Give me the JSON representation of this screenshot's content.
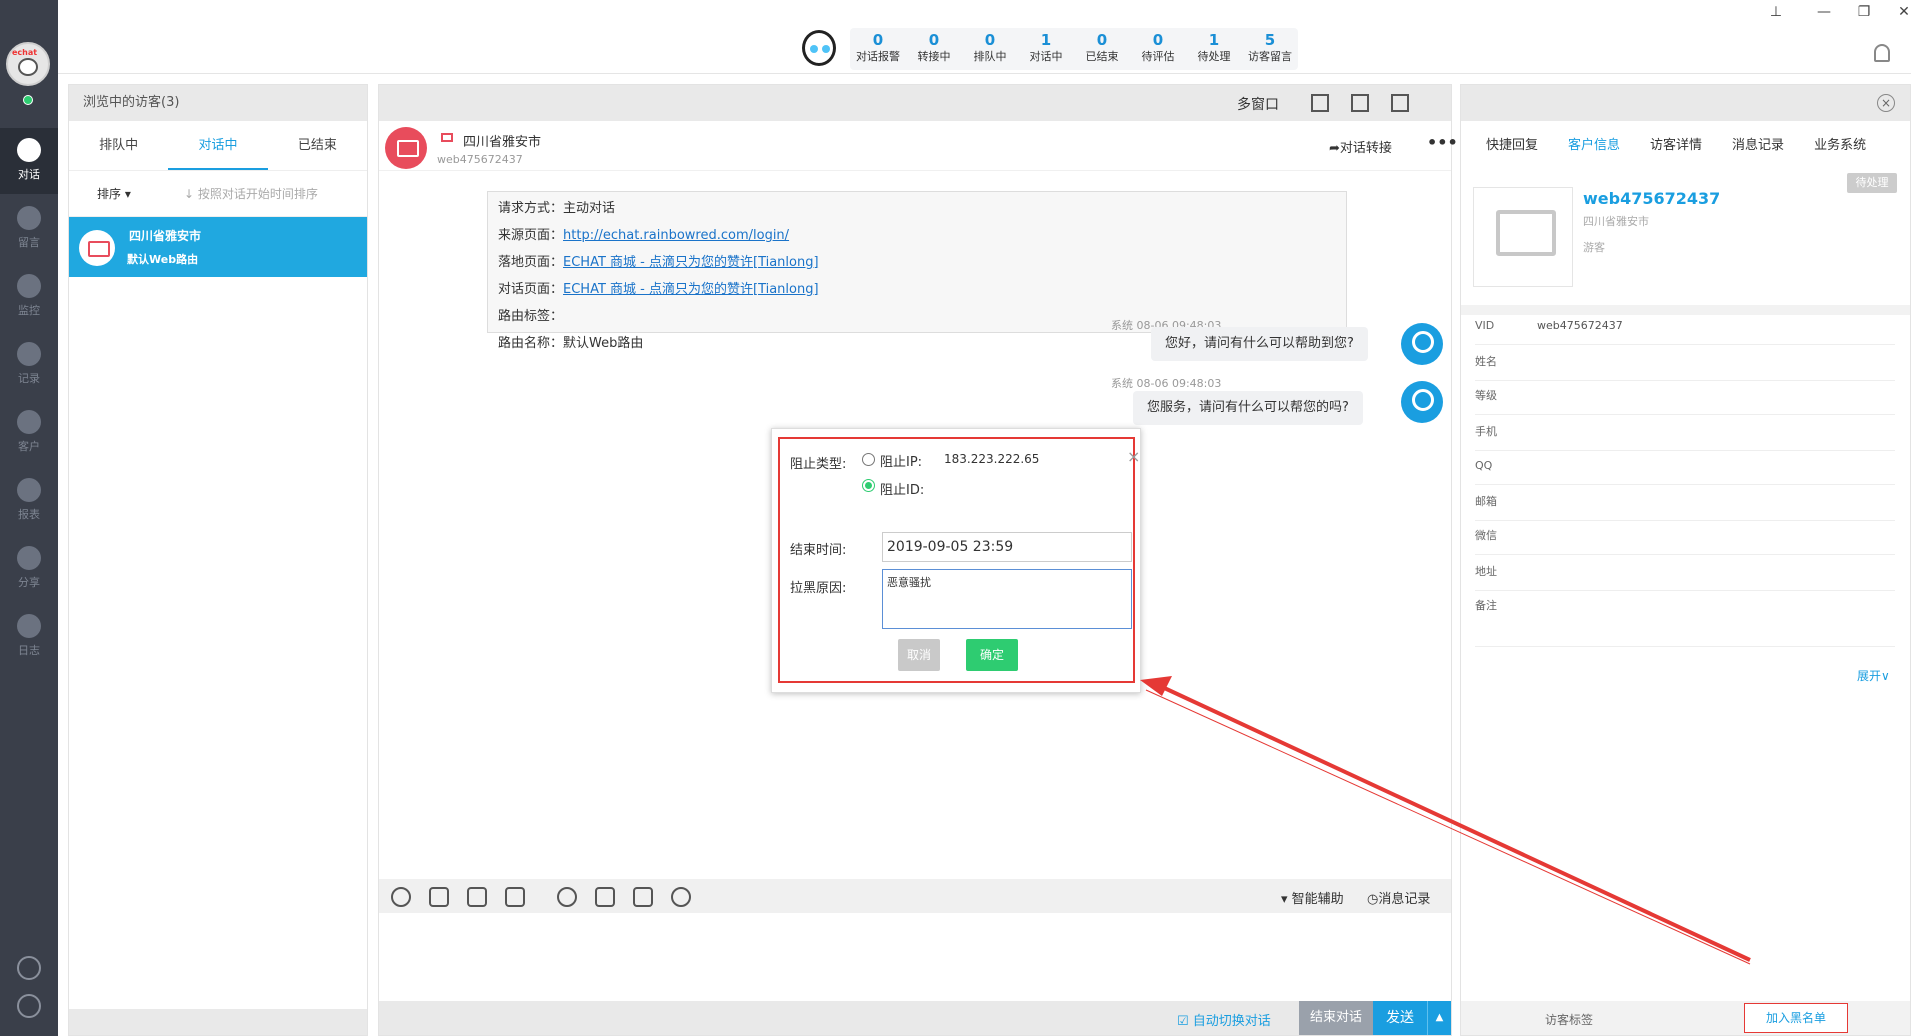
{
  "nav": {
    "avatar_tag": "echat",
    "items": [
      {
        "label": "对话",
        "icon": "chat-icon"
      },
      {
        "label": "留言",
        "icon": "mail-icon"
      },
      {
        "label": "监控",
        "icon": "eye-icon"
      },
      {
        "label": "记录",
        "icon": "clock-icon"
      },
      {
        "label": "客户",
        "icon": "contact-card-icon"
      },
      {
        "label": "报表",
        "icon": "pie-chart-icon"
      },
      {
        "label": "分享",
        "icon": "share-icon"
      },
      {
        "label": "日志",
        "icon": "clipboard-icon"
      }
    ]
  },
  "stats": [
    {
      "num": "0",
      "label": "对话报警"
    },
    {
      "num": "0",
      "label": "转接中"
    },
    {
      "num": "0",
      "label": "排队中"
    },
    {
      "num": "1",
      "label": "对话中"
    },
    {
      "num": "0",
      "label": "已结束"
    },
    {
      "num": "0",
      "label": "待评估"
    },
    {
      "num": "1",
      "label": "待处理"
    },
    {
      "num": "5",
      "label": "访客留言"
    }
  ],
  "window_controls": {
    "pin": "⊥",
    "minimize": "—",
    "restore": "❐",
    "close": "✕"
  },
  "visitor_list": {
    "title": "浏览中的访客(3)",
    "tabs": [
      "排队中",
      "对话中",
      "已结束"
    ],
    "sort_label": "排序 ▾",
    "sort_hint": "↓ 按照对话开始时间排序",
    "item": {
      "city": "四川省雅安市",
      "route": "默认Web路由"
    }
  },
  "chat": {
    "multi_window": "多窗口",
    "city": "四川省雅安市",
    "visitor_id": "web475672437",
    "transfer": "➦对话转接",
    "more": "•••",
    "info": [
      {
        "label": "请求方式：",
        "value": "主动对话",
        "link": false
      },
      {
        "label": "来源页面：",
        "value": "http://echat.rainbowred.com/login/",
        "link": true
      },
      {
        "label": "落地页面：",
        "value": "ECHAT 商城 - 点滴只为您的赞许[Tianlong]",
        "link": true
      },
      {
        "label": "对话页面：",
        "value": "ECHAT 商城 - 点滴只为您的赞许[Tianlong]",
        "link": true
      },
      {
        "label": "路由标签：",
        "value": "",
        "link": false
      },
      {
        "label": "路由名称：",
        "value": "默认Web路由",
        "link": false
      }
    ],
    "messages": [
      {
        "meta": "系统 08-06 09:48:03",
        "text": "您好，请问有什么可以帮助到您?"
      },
      {
        "meta": "系统 08-06 09:48:03",
        "text": "您服务，请问有什么可以帮您的吗?"
      }
    ],
    "smart_assist": "▾ 智能辅助",
    "message_log": "◷消息记录",
    "auto_switch": "☑ 自动切换对话",
    "end_button": "结束对话",
    "send_button": "发送",
    "send_caret": "▲"
  },
  "modal": {
    "block_type_label": "阻止类型:",
    "block_ip_label": "阻止IP:",
    "ip_value": "183.223.222.65",
    "block_id_label": "阻止ID:",
    "end_time_label": "结束时间:",
    "end_time_value": "2019-09-05 23:59",
    "reason_label": "拉黑原因:",
    "reason_value": "恶意骚扰",
    "cancel": "取消",
    "confirm": "确定",
    "close": "×",
    "selected": "block_id"
  },
  "customer": {
    "tabs": [
      "快捷回复",
      "客户信息",
      "访客详情",
      "消息记录",
      "业务系统"
    ],
    "active_tab": 1,
    "pending": "待处理",
    "name": "web475672437",
    "location": "四川省雅安市",
    "type": "游客",
    "fields": [
      {
        "label": "VID",
        "value": "web475672437"
      },
      {
        "label": "姓名",
        "value": ""
      },
      {
        "label": "等级",
        "value": ""
      },
      {
        "label": "手机",
        "value": ""
      },
      {
        "label": "QQ",
        "value": ""
      },
      {
        "label": "邮箱",
        "value": ""
      },
      {
        "label": "微信",
        "value": ""
      },
      {
        "label": "地址",
        "value": ""
      },
      {
        "label": "备注",
        "value": ""
      }
    ],
    "expand": "展开∨",
    "visitor_tag": "访客标签",
    "blacklist": "加入黑名单",
    "close": "×"
  },
  "colors": {
    "accent": "#1a9ee0",
    "highlight": "#e53935",
    "confirm": "#2ecc71",
    "sidebar": "#3a3f4a"
  }
}
